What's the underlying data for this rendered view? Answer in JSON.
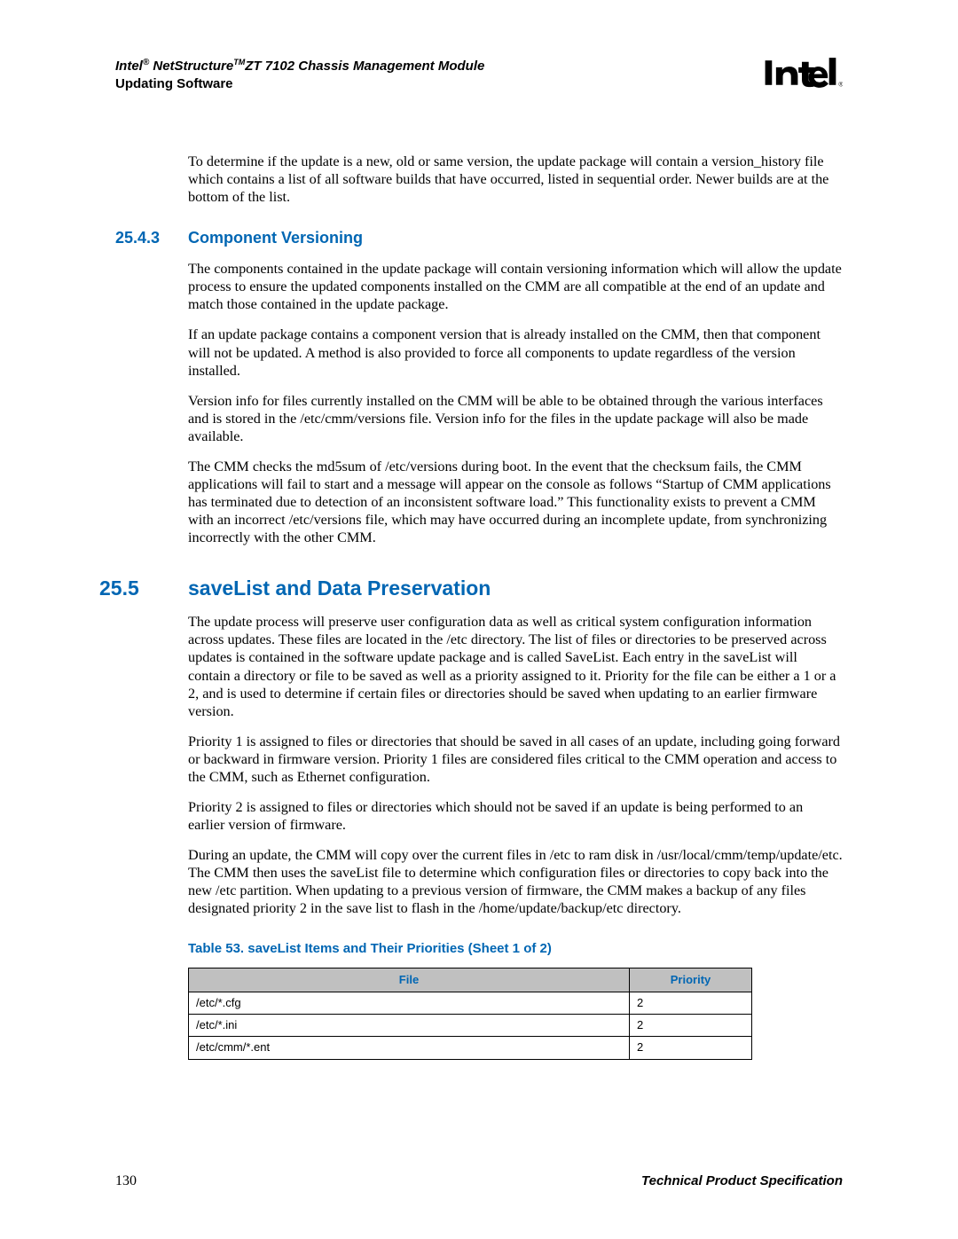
{
  "header": {
    "line1_brand": "Intel",
    "line1_reg": "®",
    "line1_net": " NetStructure",
    "line1_tm": "TM",
    "line1_rest": "ZT 7102 Chassis Management Module",
    "line2": "Updating Software"
  },
  "body": {
    "intro_para": "To determine if the update is a new, old or same version, the update package will contain a version_history file which contains a list of all software builds that have occurred, listed in sequential order. Newer builds are at the bottom of the list.",
    "sec_2543_num": "25.4.3",
    "sec_2543_title": "Component Versioning",
    "p2543_1": "The components contained in the update package will contain versioning information which will allow the update process to ensure the updated components installed on the CMM are all compatible at the end of an update and match those contained in the update package.",
    "p2543_2": "If an update package contains a component version that is already installed on the CMM, then that component will not be updated. A method is also provided to force all components to update regardless of the version installed.",
    "p2543_3": "Version info for files currently installed on the CMM will be able to be obtained through the various interfaces and is stored in the /etc/cmm/versions file. Version info for the files in the update package will also be made available.",
    "p2543_4": "The CMM checks the md5sum of /etc/versions during boot. In the event that the checksum fails, the CMM applications will fail to start and a message will appear on the console as follows “Startup of CMM applications has terminated due to detection of an inconsistent software load.” This functionality exists to prevent a CMM with an incorrect /etc/versions file, which may have occurred during an incomplete update, from synchronizing incorrectly with the other CMM.",
    "sec_255_num": "25.5",
    "sec_255_title": "saveList and Data Preservation",
    "p255_1": "The update process will preserve user configuration data as well as critical system configuration information across updates. These files are located in the /etc directory. The list of files or directories to be preserved across updates is contained in the software update package and is called SaveList. Each entry in the saveList will contain a directory or file to be saved as well as a priority assigned to it. Priority for the file can be either a 1 or a 2, and is used to determine if certain files or directories should be saved when updating to an earlier firmware version.",
    "p255_2": "Priority 1 is assigned to files or directories that should be saved in all cases of an update, including going forward or backward in firmware version. Priority 1 files are considered files critical to the CMM operation and access to the CMM, such as Ethernet configuration.",
    "p255_3": "Priority 2 is assigned to files or directories which should not be saved if an update is being performed to an earlier version of firmware.",
    "p255_4": "During an update, the CMM will copy over the current files in /etc to ram disk in /usr/local/cmm/temp/update/etc. The CMM then uses the saveList file to determine which configuration files or directories to copy back into the new /etc partition. When updating to a previous version of firmware, the CMM makes a backup of any files designated priority 2 in the save list to flash in the /home/update/backup/etc directory.",
    "table_caption": "Table 53.  saveList Items and Their Priorities (Sheet 1 of 2)",
    "table": {
      "headers": {
        "file": "File",
        "priority": "Priority"
      },
      "rows": [
        {
          "file": "/etc/*.cfg",
          "priority": "2"
        },
        {
          "file": "/etc/*.ini",
          "priority": "2"
        },
        {
          "file": "/etc/cmm/*.ent",
          "priority": "2"
        }
      ]
    }
  },
  "footer": {
    "page": "130",
    "doc": "Technical Product Specification"
  }
}
